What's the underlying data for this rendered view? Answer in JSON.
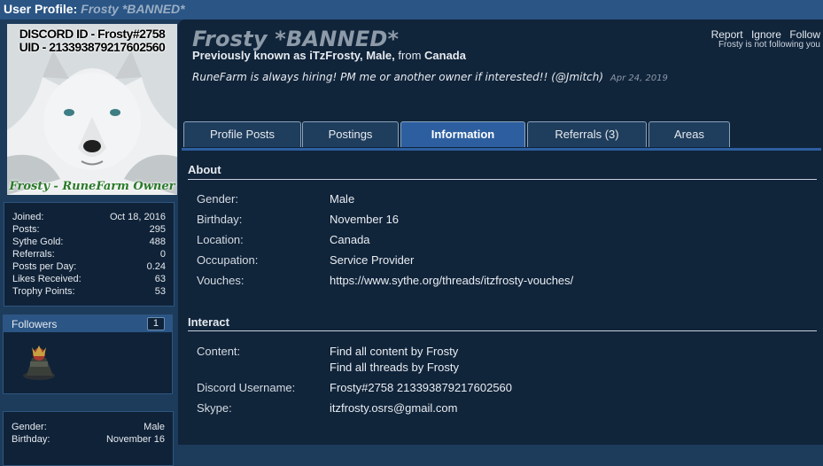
{
  "titlebar": {
    "label": "User Profile:",
    "name": "Frosty *BANNED*"
  },
  "avatar": {
    "line1": "DISCORD ID - Frosty#2758",
    "line2": "UID - 213393879217602560",
    "caption": "Frosty - RuneFarm Owner"
  },
  "stats": [
    {
      "label": "Joined:",
      "value": "Oct 18, 2016"
    },
    {
      "label": "Posts:",
      "value": "295"
    },
    {
      "label": "Sythe Gold:",
      "value": "488"
    },
    {
      "label": "Referrals:",
      "value": "0"
    },
    {
      "label": "Posts per Day:",
      "value": "0.24"
    },
    {
      "label": "Likes Received:",
      "value": "63"
    },
    {
      "label": "Trophy Points:",
      "value": "53"
    }
  ],
  "followers": {
    "title": "Followers",
    "count": "1"
  },
  "mini": [
    {
      "label": "Gender:",
      "value": "Male"
    },
    {
      "label": "Birthday:",
      "value": "November 16"
    }
  ],
  "profile": {
    "name": "Frosty *BANNED*",
    "known_prefix": "Previously known as iTzFrosty, Male,",
    "known_from": " from ",
    "location": "Canada",
    "status_text": "RuneFarm is always hiring! PM me or another owner if interested!! (@Jmitch)",
    "status_date": "Apr 24, 2019"
  },
  "actions": {
    "report": "Report",
    "ignore": "Ignore",
    "follow": "Follow",
    "not_following": "Frosty is not following you"
  },
  "tabs": [
    "Profile Posts",
    "Postings",
    "Information",
    "Referrals (3)",
    "Areas"
  ],
  "about": {
    "title": "About",
    "rows": [
      {
        "label": "Gender:",
        "value": "Male"
      },
      {
        "label": "Birthday:",
        "value": "November 16"
      },
      {
        "label": "Location:",
        "value": "Canada"
      },
      {
        "label": "Occupation:",
        "value": "Service Provider"
      },
      {
        "label": "Vouches:",
        "value": "https://www.sythe.org/threads/itzfrosty-vouches/"
      }
    ]
  },
  "interact": {
    "title": "Interact",
    "content_label": "Content:",
    "content_links": [
      "Find all content by Frosty",
      "Find all threads by Frosty"
    ],
    "discord_label": "Discord Username:",
    "discord_value": "Frosty#2758 213393879217602560",
    "skype_label": "Skype:",
    "skype_value": "itzfrosty.osrs@gmail.com"
  }
}
